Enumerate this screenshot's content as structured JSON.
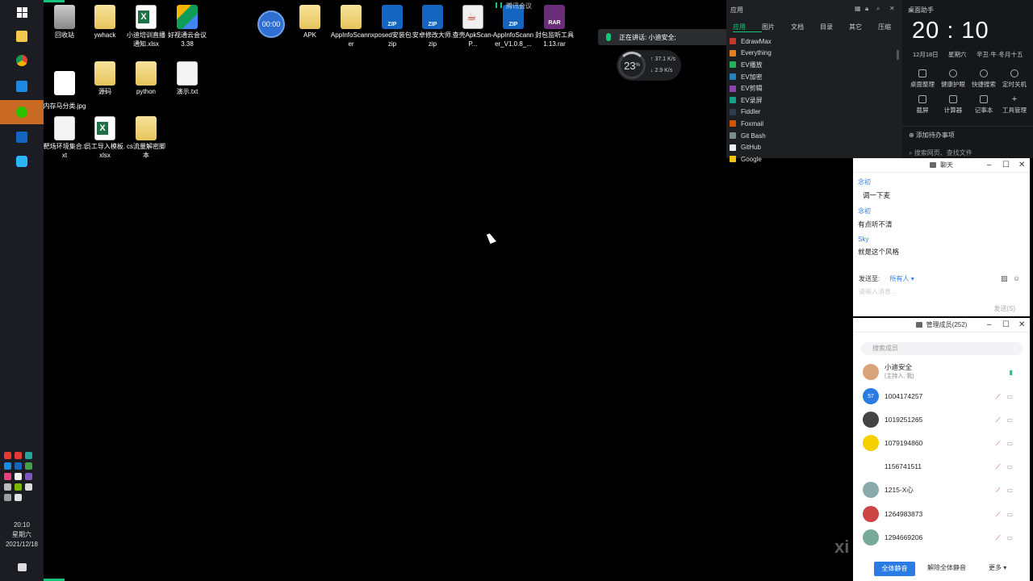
{
  "taskbar": {
    "clock_time": "20:10",
    "clock_weekday": "星期六",
    "clock_date": "2021/12/18",
    "accent": "#c86a23"
  },
  "desktop": {
    "icons": [
      {
        "label": "回收站",
        "type": "recycle-bin-icon"
      },
      {
        "label": "ywhack",
        "type": "folder-icon"
      },
      {
        "label": "小迪培训直播通知.xlsx",
        "type": "excel-icon"
      },
      {
        "label": "好视通云会议3.38",
        "type": "app-icon"
      },
      {
        "label": "APK",
        "type": "folder-icon"
      },
      {
        "label": "AppInfoScanner",
        "type": "folder-icon"
      },
      {
        "label": "xposed安装包.zip",
        "type": "zip-icon"
      },
      {
        "label": "安卓修改大师.zip",
        "type": "zip-icon"
      },
      {
        "label": "查壳ApkScan-P...",
        "type": "java-icon"
      },
      {
        "label": "AppInfoScanner_V1.0.8_...",
        "type": "zip-icon"
      },
      {
        "label": "封包监听工具1.13.rar",
        "type": "rar-icon"
      },
      {
        "label": "内存马分类.jpg",
        "type": "image-icon"
      },
      {
        "label": "源码",
        "type": "folder-icon"
      },
      {
        "label": "python",
        "type": "folder-icon"
      },
      {
        "label": "演示.txt",
        "type": "text-file-icon"
      },
      {
        "label": "靶场环境集合.txt",
        "type": "text-file-icon"
      },
      {
        "label": "员工导入模板.xlsx",
        "type": "excel-icon"
      },
      {
        "label": "cs流量解密脚本",
        "type": "folder-icon"
      }
    ],
    "record_timer": "00:00"
  },
  "meeting": {
    "app_label": "腾讯会议",
    "speaking": "正在讲话: 小迪安全;"
  },
  "netmon": {
    "cpu_percent": "23",
    "upload": "37.1",
    "download": "2.9",
    "unit": "K/s"
  },
  "launcher": {
    "title": "应用",
    "tabs": [
      "应用",
      "图片",
      "文档",
      "目录",
      "其它",
      "压缩"
    ],
    "items": [
      {
        "label": "EdrawMax",
        "color": "#c0392b"
      },
      {
        "label": "Everything",
        "color": "#e67e22"
      },
      {
        "label": "EV播放",
        "color": "#27ae60"
      },
      {
        "label": "EV加密",
        "color": "#2980b9"
      },
      {
        "label": "EV剪辑",
        "color": "#8e44ad"
      },
      {
        "label": "EV录屏",
        "color": "#16a085"
      },
      {
        "label": "Fiddler",
        "color": "#2c3e50"
      },
      {
        "label": "Foxmail",
        "color": "#d35400"
      },
      {
        "label": "Git Bash",
        "color": "#7f8c8d"
      },
      {
        "label": "GitHub",
        "color": "#ecf0f1"
      },
      {
        "label": "Google",
        "color": "#f1c40f"
      }
    ]
  },
  "assistant": {
    "title": "桌面助手",
    "clock": "20 : 10",
    "date": "12月18日",
    "weekday": "星期六",
    "lunar": "辛丑·牛·冬月十五",
    "tools": [
      {
        "label": "桌面整理",
        "icon": "desktop-organize-icon"
      },
      {
        "label": "健康护眼",
        "icon": "eye-icon"
      },
      {
        "label": "快捷搜索",
        "icon": "search-icon"
      },
      {
        "label": "定时关机",
        "icon": "power-icon"
      },
      {
        "label": "截屏",
        "icon": "crop-icon"
      },
      {
        "label": "计算器",
        "icon": "calculator-icon"
      },
      {
        "label": "记事本",
        "icon": "notepad-icon"
      },
      {
        "label": "工具管理",
        "icon": "plus-icon"
      }
    ],
    "todo": "添加待办事项",
    "search_placeholder": "搜索网页、查找文件"
  },
  "chat": {
    "title": "聊天",
    "messages": [
      {
        "name": "念初",
        "text": "调一下麦"
      },
      {
        "name": "念初",
        "text": "有点听不清"
      },
      {
        "name": "Sky",
        "text": "就是这个风格"
      }
    ],
    "send_to_label": "发送至:",
    "send_to_value": "所有人",
    "input_placeholder": "请输入消息...",
    "send_button": "发送(S)"
  },
  "members": {
    "title": "管理成员(252)",
    "search_placeholder": "搜索成员",
    "list": [
      {
        "name": "小迪安全",
        "role": "(主持人, 我)",
        "avatar": "#d9a37a"
      },
      {
        "name": "1004174257",
        "role": "",
        "avatar": "#2a7be4",
        "initials": "57"
      },
      {
        "name": "1019251265",
        "role": "",
        "avatar": "#444"
      },
      {
        "name": "1079194860",
        "role": "",
        "avatar": "#f5d000"
      },
      {
        "name": "1156741511",
        "role": "",
        "avatar": "#ffffff"
      },
      {
        "name": "1215-X心",
        "role": "",
        "avatar": "#8aa"
      },
      {
        "name": "1264983873",
        "role": "",
        "avatar": "#c44"
      },
      {
        "name": "1294669206",
        "role": "",
        "avatar": "#7a9"
      }
    ],
    "mute_all": "全体静音",
    "unmute_all": "解除全体静音",
    "more": "更多"
  },
  "watermark": "xi"
}
